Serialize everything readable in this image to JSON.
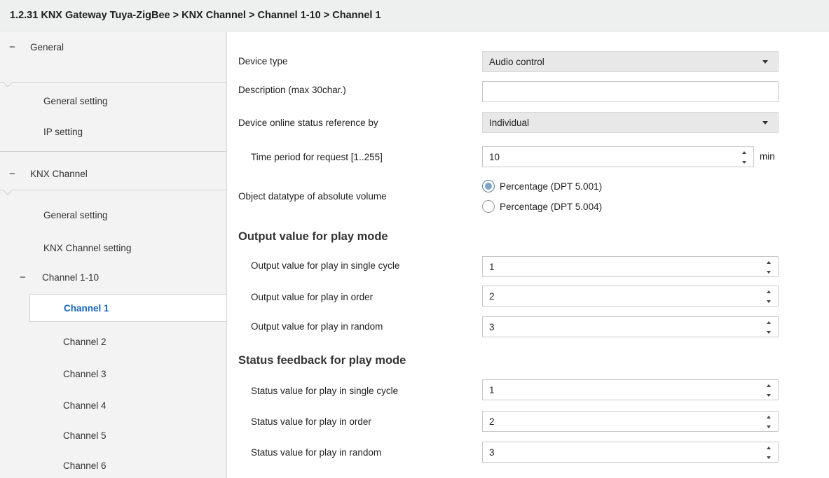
{
  "breadcrumb": "1.2.31 KNX Gateway Tuya-ZigBee > KNX Channel > Channel 1-10 > Channel 1",
  "sidebar": {
    "groups": [
      {
        "label": "General",
        "items": [
          "General setting",
          "IP setting"
        ]
      },
      {
        "label": "KNX Channel",
        "items": [
          "General setting",
          "KNX Channel setting"
        ]
      }
    ],
    "subgroup": {
      "label": "Channel 1-10"
    },
    "channels": [
      "Channel 1",
      "Channel 2",
      "Channel 3",
      "Channel 4",
      "Channel 5",
      "Channel 6"
    ],
    "selected": "Channel 1",
    "collapse_glyph": "−"
  },
  "form": {
    "device_type": {
      "label": "Device type",
      "value": "Audio control"
    },
    "description": {
      "label": "Description (max 30char.)",
      "value": ""
    },
    "online_status": {
      "label": "Device online status reference by",
      "value": "Individual"
    },
    "time_period": {
      "label": "Time period for request [1..255]",
      "value": "10",
      "unit": "min"
    },
    "datatype": {
      "label": "Object datatype of absolute volume",
      "options": [
        "Percentage (DPT 5.001)",
        "Percentage (DPT 5.004)"
      ],
      "selected_index": 0
    },
    "output_section": {
      "title": "Output value for play mode",
      "rows": [
        {
          "label": "Output value for play in single cycle",
          "value": "1"
        },
        {
          "label": "Output value for play in order",
          "value": "2"
        },
        {
          "label": "Output value for play in random",
          "value": "3"
        }
      ]
    },
    "status_section": {
      "title": "Status feedback for play mode",
      "rows": [
        {
          "label": "Status value for play in single cycle",
          "value": "1"
        },
        {
          "label": "Status value for play in order",
          "value": "2"
        },
        {
          "label": "Status value for play in random",
          "value": "3"
        }
      ]
    }
  },
  "colors": {
    "selected_text": "#1565c0",
    "sidebar_bg": "#f3f3f3",
    "titlebar_bg": "#eef0f0",
    "combo_bg": "#e8e8e8",
    "radio_fill": "#7da3c9"
  }
}
